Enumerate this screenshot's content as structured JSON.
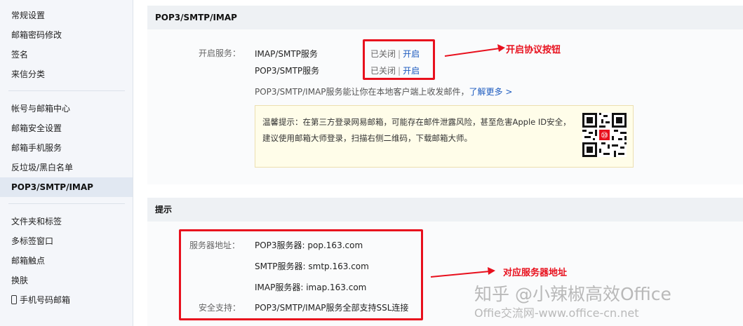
{
  "sidebar": {
    "group1": [
      "常规设置",
      "邮箱密码修改",
      "签名",
      "来信分类"
    ],
    "group2": [
      "帐号与邮箱中心",
      "邮箱安全设置",
      "邮箱手机服务",
      "反垃圾/黑白名单",
      "POP3/SMTP/IMAP"
    ],
    "group3": [
      "文件夹和标签",
      "多标签窗口",
      "邮箱触点",
      "换肤",
      "手机号码邮箱"
    ],
    "active": "POP3/SMTP/IMAP"
  },
  "pop_section": {
    "header": "POP3/SMTP/IMAP",
    "service_label": "开启服务：",
    "services": [
      {
        "name": "IMAP/SMTP服务",
        "status": "已关闭",
        "action": "开启"
      },
      {
        "name": "POP3/SMTP服务",
        "status": "已关闭",
        "action": "开启"
      }
    ],
    "separator": "|",
    "description": "POP3/SMTP/IMAP服务能让你在本地客户端上收发邮件，",
    "learn_more": "了解更多 >",
    "tip": "温馨提示：在第三方登录网易邮箱，可能存在邮件泄露风险，甚至危害Apple ID安全，建议使用邮箱大师登录，扫描右侧二维码，下载邮箱大师。",
    "qr_badge": "⑩"
  },
  "hint_section": {
    "header": "提示",
    "server_label": "服务器地址：",
    "servers": [
      "POP3服务器: pop.163.com",
      "SMTP服务器: smtp.163.com",
      "IMAP服务器: imap.163.com"
    ],
    "security_label": "安全支持：",
    "security_text": "POP3/SMTP/IMAP服务全部支持SSL连接"
  },
  "annotations": {
    "protocol_button": "开启协议按钮",
    "server_address": "对应服务器地址"
  },
  "watermark": {
    "line1": "知乎 @小辣椒高效Office",
    "line2": "Offie交流网-www.office-cn.net"
  },
  "colors": {
    "annotation_red": "#e8101d",
    "link_blue": "#1d5bbf",
    "sidebar_bg": "#f4f6fa",
    "tip_bg": "#fffde9"
  }
}
